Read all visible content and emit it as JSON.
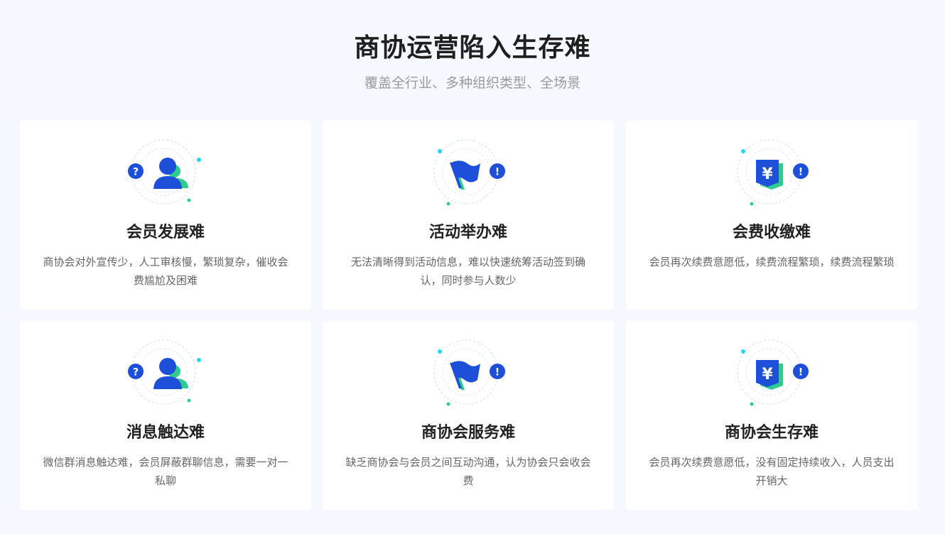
{
  "header": {
    "title": "商协运营陷入生存难",
    "subtitle": "覆盖全行业、多种组织类型、全场景"
  },
  "colors": {
    "primary_blue": "#1d4fd8",
    "accent_green": "#2ecc8f",
    "accent_cyan": "#22d8f0",
    "background": "#f5f8fe"
  },
  "cards": [
    {
      "icon": "member-icon",
      "badge": "?",
      "title": "会员发展难",
      "desc": "商协会对外宣传少，人工审核慢，繁琐复杂，催收会费尴尬及困难"
    },
    {
      "icon": "flag-icon",
      "badge": "!",
      "title": "活动举办难",
      "desc": "无法清晰得到活动信息，难以快速统筹活动签到确认，同时参与人数少"
    },
    {
      "icon": "yuan-icon",
      "badge": "!",
      "title": "会费收缴难",
      "desc": "会员再次续费意愿低，续费流程繁琐，续费流程繁琐"
    },
    {
      "icon": "member-icon",
      "badge": "?",
      "title": "消息触达难",
      "desc": "微信群消息触达难，会员屏蔽群聊信息，需要一对一私聊"
    },
    {
      "icon": "flag-icon",
      "badge": "!",
      "title": "商协会服务难",
      "desc": "缺乏商协会与会员之间互动沟通，认为协会只会收会费"
    },
    {
      "icon": "yuan-icon",
      "badge": "!",
      "title": "商协会生存难",
      "desc": "会员再次续费意愿低，没有固定持续收入，人员支出开销大"
    }
  ]
}
